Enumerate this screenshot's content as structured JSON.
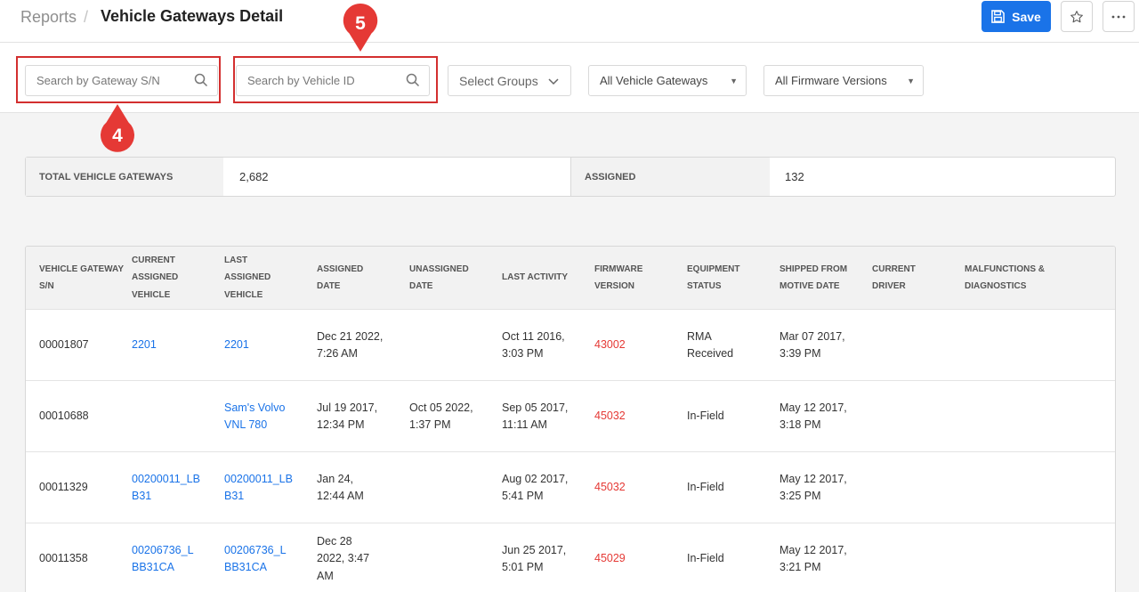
{
  "header": {
    "breadcrumb_root": "Reports",
    "breadcrumb_sep": "/",
    "title": "Vehicle Gateways Detail",
    "save_label": "Save"
  },
  "filters": {
    "gateway_search_placeholder": "Search by Gateway S/N",
    "vehicle_search_placeholder": "Search by Vehicle ID",
    "groups_label": "Select Groups",
    "gateways_select": "All Vehicle Gateways",
    "firmware_select": "All Firmware Versions"
  },
  "callouts": {
    "gateway_search": "4",
    "vehicle_search": "5"
  },
  "summary": {
    "total_label": "TOTAL VEHICLE GATEWAYS",
    "total_value": "2,682",
    "assigned_label": "ASSIGNED",
    "assigned_value": "132"
  },
  "table": {
    "columns": [
      "VEHICLE GATEWAY S/N",
      "CURRENT ASSIGNED VEHICLE",
      "LAST ASSIGNED VEHICLE",
      "ASSIGNED DATE",
      "UNASSIGNED DATE",
      "LAST ACTIVITY",
      "FIRMWARE VERSION",
      "EQUIPMENT STATUS",
      "SHIPPED FROM MOTIVE DATE",
      "CURRENT DRIVER",
      "MALFUNCTIONS & DIAGNOSTICS"
    ],
    "rows": [
      {
        "sn": "00001807",
        "current_vehicle": "2201",
        "last_vehicle": "2201",
        "assigned_date": "Dec 21 2022, 7:26 AM",
        "unassigned_date": "",
        "last_activity": "Oct 11 2016, 3:03 PM",
        "firmware": "43002",
        "status": "RMA Received",
        "shipped": "Mar 07 2017, 3:39 PM",
        "driver": "",
        "malfunctions": ""
      },
      {
        "sn": "00010688",
        "current_vehicle": "",
        "last_vehicle": "Sam's Volvo VNL 780",
        "assigned_date": "Jul 19 2017, 12:34 PM",
        "unassigned_date": "Oct 05 2022, 1:37 PM",
        "last_activity": "Sep 05 2017, 11:11 AM",
        "firmware": "45032",
        "status": "In-Field",
        "shipped": "May 12 2017, 3:18 PM",
        "driver": "",
        "malfunctions": ""
      },
      {
        "sn": "00011329",
        "current_vehicle": "00200011_LBB31",
        "last_vehicle": "00200011_LBB31",
        "assigned_date": "Jan 24, 12:44 AM",
        "unassigned_date": "",
        "last_activity": "Aug 02 2017, 5:41 PM",
        "firmware": "45032",
        "status": "In-Field",
        "shipped": "May 12 2017, 3:25 PM",
        "driver": "",
        "malfunctions": ""
      },
      {
        "sn": "00011358",
        "current_vehicle": "00206736_LBB31CA",
        "last_vehicle": "00206736_LBB31CA",
        "assigned_date": "Dec 28 2022, 3:47 AM",
        "unassigned_date": "",
        "last_activity": "Jun 25 2017, 5:01 PM",
        "firmware": "45029",
        "status": "In-Field",
        "shipped": "May 12 2017, 3:21 PM",
        "driver": "",
        "malfunctions": ""
      }
    ]
  },
  "colors": {
    "accent": "#1a73e8",
    "firmware": "#e53935",
    "callout": "#e53935"
  },
  "icons": [
    "save-icon",
    "star-icon",
    "more-icon",
    "search-icon",
    "chevron-down-icon",
    "caret-down-icon"
  ]
}
